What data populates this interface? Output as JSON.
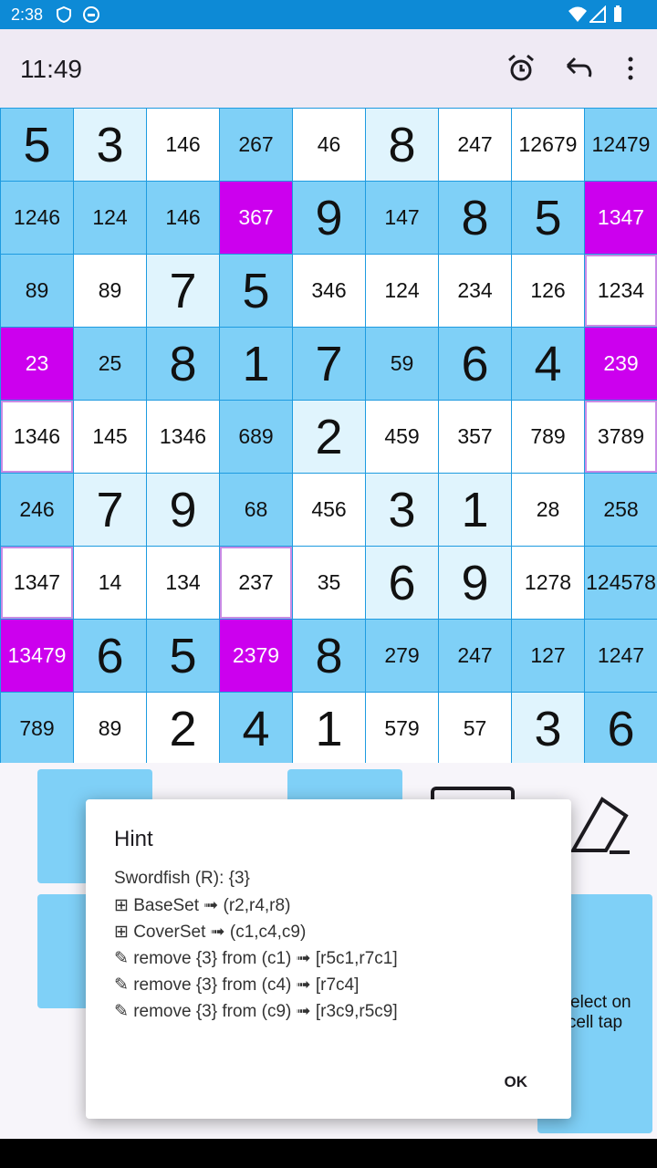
{
  "status": {
    "time": "2:38"
  },
  "app_bar": {
    "clock": "11:49"
  },
  "grid": [
    [
      {
        "v": "5",
        "k": "big",
        "s": "selected"
      },
      {
        "v": "3",
        "k": "big",
        "s": "filled-light"
      },
      {
        "v": "146",
        "k": "cand",
        "s": "empty"
      },
      {
        "v": "267",
        "k": "cand",
        "s": "selected"
      },
      {
        "v": "46",
        "k": "cand",
        "s": "empty"
      },
      {
        "v": "8",
        "k": "big",
        "s": "filled-light"
      },
      {
        "v": "247",
        "k": "cand",
        "s": "empty"
      },
      {
        "v": "12679",
        "k": "cand",
        "s": "empty"
      },
      {
        "v": "12479",
        "k": "cand",
        "s": "selected"
      }
    ],
    [
      {
        "v": "1246",
        "k": "cand",
        "s": "selected"
      },
      {
        "v": "124",
        "k": "cand",
        "s": "selected"
      },
      {
        "v": "146",
        "k": "cand",
        "s": "selected"
      },
      {
        "v": "367",
        "k": "cand",
        "s": "hl"
      },
      {
        "v": "9",
        "k": "big",
        "s": "selected"
      },
      {
        "v": "147",
        "k": "cand",
        "s": "selected"
      },
      {
        "v": "8",
        "k": "big",
        "s": "selected"
      },
      {
        "v": "5",
        "k": "big",
        "s": "selected"
      },
      {
        "v": "1347",
        "k": "cand",
        "s": "hl"
      }
    ],
    [
      {
        "v": "89",
        "k": "cand",
        "s": "selected"
      },
      {
        "v": "89",
        "k": "cand",
        "s": "empty"
      },
      {
        "v": "7",
        "k": "big",
        "s": "filled-light"
      },
      {
        "v": "5",
        "k": "big",
        "s": "selected"
      },
      {
        "v": "346",
        "k": "cand",
        "s": "empty"
      },
      {
        "v": "124",
        "k": "cand",
        "s": "empty"
      },
      {
        "v": "234",
        "k": "cand",
        "s": "empty"
      },
      {
        "v": "126",
        "k": "cand",
        "s": "empty"
      },
      {
        "v": "1234",
        "k": "cand",
        "s": "outline"
      }
    ],
    [
      {
        "v": "23",
        "k": "cand",
        "s": "hl"
      },
      {
        "v": "25",
        "k": "cand",
        "s": "selected"
      },
      {
        "v": "8",
        "k": "big",
        "s": "selected"
      },
      {
        "v": "1",
        "k": "big",
        "s": "selected"
      },
      {
        "v": "7",
        "k": "big",
        "s": "selected"
      },
      {
        "v": "59",
        "k": "cand",
        "s": "selected"
      },
      {
        "v": "6",
        "k": "big",
        "s": "selected"
      },
      {
        "v": "4",
        "k": "big",
        "s": "selected"
      },
      {
        "v": "239",
        "k": "cand",
        "s": "hl"
      }
    ],
    [
      {
        "v": "1346",
        "k": "cand",
        "s": "outline"
      },
      {
        "v": "145",
        "k": "cand",
        "s": "empty"
      },
      {
        "v": "1346",
        "k": "cand",
        "s": "empty"
      },
      {
        "v": "689",
        "k": "cand",
        "s": "selected"
      },
      {
        "v": "2",
        "k": "big",
        "s": "filled-light"
      },
      {
        "v": "459",
        "k": "cand",
        "s": "empty"
      },
      {
        "v": "357",
        "k": "cand",
        "s": "empty"
      },
      {
        "v": "789",
        "k": "cand",
        "s": "empty"
      },
      {
        "v": "3789",
        "k": "cand",
        "s": "outline"
      }
    ],
    [
      {
        "v": "246",
        "k": "cand",
        "s": "selected"
      },
      {
        "v": "7",
        "k": "big",
        "s": "filled-light"
      },
      {
        "v": "9",
        "k": "big",
        "s": "filled-light"
      },
      {
        "v": "68",
        "k": "cand",
        "s": "selected"
      },
      {
        "v": "456",
        "k": "cand",
        "s": "empty"
      },
      {
        "v": "3",
        "k": "big",
        "s": "filled-light"
      },
      {
        "v": "1",
        "k": "big",
        "s": "filled-light"
      },
      {
        "v": "28",
        "k": "cand",
        "s": "empty"
      },
      {
        "v": "258",
        "k": "cand",
        "s": "selected"
      }
    ],
    [
      {
        "v": "1347",
        "k": "cand",
        "s": "outline"
      },
      {
        "v": "14",
        "k": "cand",
        "s": "empty"
      },
      {
        "v": "134",
        "k": "cand",
        "s": "empty"
      },
      {
        "v": "237",
        "k": "cand",
        "s": "outline"
      },
      {
        "v": "35",
        "k": "cand",
        "s": "empty"
      },
      {
        "v": "6",
        "k": "big",
        "s": "filled-light"
      },
      {
        "v": "9",
        "k": "big",
        "s": "filled-light"
      },
      {
        "v": "1278",
        "k": "cand",
        "s": "empty"
      },
      {
        "v": "124578",
        "k": "cand",
        "s": "selected"
      }
    ],
    [
      {
        "v": "13479",
        "k": "cand",
        "s": "hl"
      },
      {
        "v": "6",
        "k": "big",
        "s": "selected"
      },
      {
        "v": "5",
        "k": "big",
        "s": "selected"
      },
      {
        "v": "2379",
        "k": "cand",
        "s": "hl"
      },
      {
        "v": "8",
        "k": "big",
        "s": "selected"
      },
      {
        "v": "279",
        "k": "cand",
        "s": "selected"
      },
      {
        "v": "247",
        "k": "cand",
        "s": "selected"
      },
      {
        "v": "127",
        "k": "cand",
        "s": "selected"
      },
      {
        "v": "1247",
        "k": "cand",
        "s": "selected"
      }
    ],
    [
      {
        "v": "789",
        "k": "cand",
        "s": "selected"
      },
      {
        "v": "89",
        "k": "cand",
        "s": "empty"
      },
      {
        "v": "2",
        "k": "big",
        "s": "empty"
      },
      {
        "v": "4",
        "k": "big",
        "s": "selected"
      },
      {
        "v": "1",
        "k": "big",
        "s": "empty"
      },
      {
        "v": "579",
        "k": "cand",
        "s": "empty"
      },
      {
        "v": "57",
        "k": "cand",
        "s": "empty"
      },
      {
        "v": "3",
        "k": "big",
        "s": "filled-light"
      },
      {
        "v": "6",
        "k": "big",
        "s": "selected"
      }
    ]
  ],
  "bottom": {
    "select_label": "Select on cell tap"
  },
  "dialog": {
    "title": "Hint",
    "lines": [
      "Swordfish (R): {3}",
      "⊞ BaseSet ➟ (r2,r4,r8)",
      "⊞ CoverSet ➟ (c1,c4,c9)",
      "✎ remove {3} from (c1) ➟ [r5c1,r7c1]",
      "✎ remove {3} from (c4) ➟ [r7c4]",
      "✎ remove {3} from (c9) ➟ [r3c9,r5c9]"
    ],
    "ok": "OK"
  }
}
